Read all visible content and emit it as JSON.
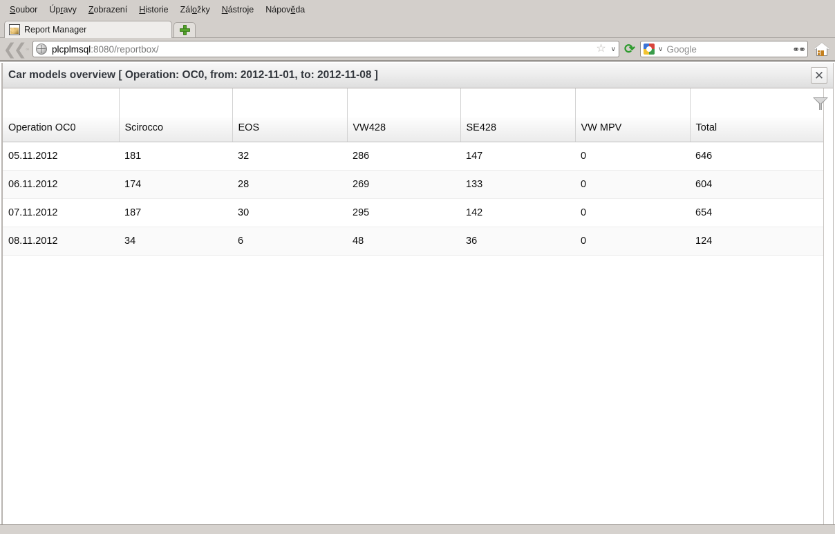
{
  "browser": {
    "menu": [
      {
        "label": "Soubor",
        "mnemonic_index": 0
      },
      {
        "label": "Úpravy",
        "mnemonic_index": 2
      },
      {
        "label": "Zobrazení",
        "mnemonic_index": 0
      },
      {
        "label": "Historie",
        "mnemonic_index": 0
      },
      {
        "label": "Záložky",
        "mnemonic_index": 3
      },
      {
        "label": "Nástroje",
        "mnemonic_index": 0
      },
      {
        "label": "Nápověda",
        "mnemonic_index": 5
      }
    ],
    "tab": {
      "title": "Report Manager",
      "favicon": "image-favicon-icon"
    },
    "new_tab_button": {
      "icon": "plus-icon",
      "label": "+"
    },
    "nav": {
      "back_forward": "back-arrow-icon",
      "reload_icon": "reload-icon",
      "reload_glyph": "⟳",
      "star_glyph": "☆",
      "chevron_glyph": "∨",
      "home_icon": "home-icon"
    },
    "url": {
      "host": "plcplmsql",
      "path": ":8080/reportbox/",
      "site_icon": "globe-icon"
    },
    "search": {
      "engine": "Google",
      "placeholder": "Google",
      "engine_icon": "google-logo-icon",
      "binoculars_glyph": "⚭⚭"
    }
  },
  "dialog": {
    "title": "Car models overview [ Operation: OC0, from: 2012-11-01, to: 2012-11-08 ]",
    "close_glyph": "✕",
    "filter_icon": "funnel-filter-icon"
  },
  "table": {
    "columns": [
      "Operation OC0",
      "Scirocco",
      "EOS",
      "VW428",
      "SE428",
      "VW MPV",
      "Total"
    ],
    "rows": [
      [
        "05.11.2012",
        "181",
        "32",
        "286",
        "147",
        "0",
        "646"
      ],
      [
        "06.11.2012",
        "174",
        "28",
        "269",
        "133",
        "0",
        "604"
      ],
      [
        "07.11.2012",
        "187",
        "30",
        "295",
        "142",
        "0",
        "654"
      ],
      [
        "08.11.2012",
        "34",
        "6",
        "48",
        "36",
        "0",
        "124"
      ]
    ]
  },
  "statusbar": {
    "text": ""
  },
  "colors": {
    "chrome_bg": "#d3cfcb",
    "tab_active_bg": "#efedeb",
    "title_text": "#33373d",
    "row_alt_bg": "#fafafa",
    "accent_green": "#53a32a"
  }
}
